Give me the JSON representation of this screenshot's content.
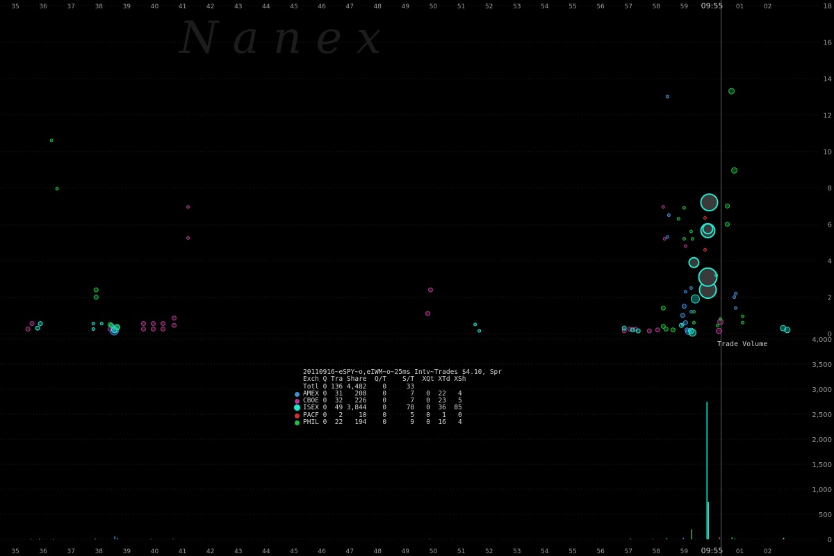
{
  "watermark": "N a n e x",
  "volume_title": "Trade Volume",
  "current_time_label": "09:55",
  "summary": {
    "title": "20110916~eSPY~o,eIWM~o~25ms Intv~Trades $4.10, Spr",
    "header": "Exch Q Tra Share  Q/T    S/T  XQt XTd XSh",
    "total": "Totl 0 136 4,482    0     33",
    "rows": [
      {
        "exch": "AMEX",
        "text": "AMEX 0  31   208    0      7   0  22   4",
        "color": "#3d8fd6"
      },
      {
        "exch": "CBOE",
        "text": "CBOE 0  32   226    0      7   0  23   5",
        "color": "#b03a8e"
      },
      {
        "exch": "ISEX",
        "text": "ISEX 0  49 3,844    0     78   0  36  85",
        "color": "#22e8d0"
      },
      {
        "exch": "PACF",
        "text": "PACF 0   2    10    0      5   0   1   0",
        "color": "#d83030"
      },
      {
        "exch": "PHIL",
        "text": "PHIL 0  22   194    0      9   0  16   4",
        "color": "#22c040"
      }
    ]
  },
  "chart_data": [
    {
      "type": "scatter",
      "title": "",
      "xlabel": "",
      "ylabel": "",
      "x_ticks": [
        "35",
        "36",
        "37",
        "38",
        "39",
        "40",
        "41",
        "42",
        "43",
        "44",
        "45",
        "46",
        "47",
        "48",
        "49",
        "50",
        "51",
        "52",
        "53",
        "54",
        "55",
        "56",
        "57",
        "58",
        "59",
        "09:55",
        "01",
        "02"
      ],
      "ylim": [
        0,
        18
      ],
      "y_ticks": [
        0,
        2,
        4,
        6,
        8,
        10,
        12,
        14,
        16,
        18
      ],
      "legend": "bottom-center table",
      "series": [
        {
          "name": "AMEX",
          "color": "#3d8fd6",
          "points": [
            {
              "x": 38.15,
              "y": 0.35,
              "s": 3
            },
            {
              "x": 38.25,
              "y": 0.2,
              "s": 4
            },
            {
              "x": 38.2,
              "y": 0.15,
              "s": 6
            },
            {
              "x": 58.05,
              "y": 13.0,
              "s": 2
            },
            {
              "x": 58.05,
              "y": 5.3,
              "s": 2
            },
            {
              "x": 58.1,
              "y": 6.5,
              "s": 2
            },
            {
              "x": 58.6,
              "y": 1.0,
              "s": 3
            },
            {
              "x": 58.65,
              "y": 1.5,
              "s": 3
            },
            {
              "x": 58.7,
              "y": 2.3,
              "s": 2
            },
            {
              "x": 58.7,
              "y": 0.6,
              "s": 3
            },
            {
              "x": 58.75,
              "y": 0.2,
              "s": 3
            },
            {
              "x": 58.8,
              "y": 0.1,
              "s": 4
            },
            {
              "x": 58.6,
              "y": 0.5,
              "s": 2
            },
            {
              "x": 58.9,
              "y": 1.2,
              "s": 2
            },
            {
              "x": 58.9,
              "y": 2.5,
              "s": 2
            },
            {
              "x": 60.45,
              "y": 2.0,
              "s": 2
            },
            {
              "x": 60.5,
              "y": 1.4,
              "s": 2
            },
            {
              "x": 60.5,
              "y": 2.2,
              "s": 2
            }
          ]
        },
        {
          "name": "CBOE",
          "color": "#b03a8e",
          "points": [
            {
              "x": 35.1,
              "y": 0.25,
              "s": 3
            },
            {
              "x": 35.25,
              "y": 0.55,
              "s": 3
            },
            {
              "x": 38.05,
              "y": 0.25,
              "s": 3
            },
            {
              "x": 39.25,
              "y": 0.25,
              "s": 3
            },
            {
              "x": 39.25,
              "y": 0.55,
              "s": 3
            },
            {
              "x": 39.6,
              "y": 0.25,
              "s": 3
            },
            {
              "x": 39.6,
              "y": 0.55,
              "s": 3
            },
            {
              "x": 39.95,
              "y": 0.25,
              "s": 3
            },
            {
              "x": 39.95,
              "y": 0.55,
              "s": 3
            },
            {
              "x": 40.35,
              "y": 0.45,
              "s": 3
            },
            {
              "x": 40.35,
              "y": 0.85,
              "s": 3
            },
            {
              "x": 40.85,
              "y": 6.95,
              "s": 2
            },
            {
              "x": 40.85,
              "y": 5.25,
              "s": 2
            },
            {
              "x": 49.45,
              "y": 1.1,
              "s": 3
            },
            {
              "x": 49.55,
              "y": 2.4,
              "s": 3
            },
            {
              "x": 56.5,
              "y": 0.15,
              "s": 3
            },
            {
              "x": 56.7,
              "y": 0.25,
              "s": 3
            },
            {
              "x": 56.9,
              "y": 0.25,
              "s": 3
            },
            {
              "x": 57.4,
              "y": 0.15,
              "s": 3
            },
            {
              "x": 57.7,
              "y": 0.2,
              "s": 3
            },
            {
              "x": 57.9,
              "y": 6.95,
              "s": 2
            },
            {
              "x": 57.95,
              "y": 5.2,
              "s": 2
            },
            {
              "x": 58.7,
              "y": 4.8,
              "s": 2
            },
            {
              "x": 59.9,
              "y": 0.15,
              "s": 4
            },
            {
              "x": 59.95,
              "y": 0.65,
              "s": 4
            }
          ]
        },
        {
          "name": "ISEX",
          "color": "#22e8d0",
          "points": [
            {
              "x": 35.45,
              "y": 0.3,
              "s": 3
            },
            {
              "x": 35.55,
              "y": 0.55,
              "s": 3
            },
            {
              "x": 37.45,
              "y": 0.25,
              "s": 2
            },
            {
              "x": 37.45,
              "y": 0.55,
              "s": 2
            },
            {
              "x": 37.75,
              "y": 0.55,
              "s": 2
            },
            {
              "x": 38.1,
              "y": 0.45,
              "s": 3
            },
            {
              "x": 38.3,
              "y": 0.35,
              "s": 4
            },
            {
              "x": 38.2,
              "y": 0.2,
              "s": 4
            },
            {
              "x": 51.15,
              "y": 0.5,
              "s": 2
            },
            {
              "x": 51.3,
              "y": 0.15,
              "s": 2
            },
            {
              "x": 56.5,
              "y": 0.3,
              "s": 3
            },
            {
              "x": 56.8,
              "y": 0.2,
              "s": 3
            },
            {
              "x": 57.0,
              "y": 0.15,
              "s": 3
            },
            {
              "x": 58.55,
              "y": 0.45,
              "s": 3
            },
            {
              "x": 58.9,
              "y": 0.15,
              "s": 4
            },
            {
              "x": 58.95,
              "y": 0.05,
              "s": 5
            },
            {
              "x": 59.05,
              "y": 1.9,
              "s": 6
            },
            {
              "x": 59.0,
              "y": 3.9,
              "s": 7
            },
            {
              "x": 59.5,
              "y": 2.4,
              "s": 12
            },
            {
              "x": 59.5,
              "y": 3.1,
              "s": 13
            },
            {
              "x": 59.5,
              "y": 5.65,
              "s": 10
            },
            {
              "x": 59.5,
              "y": 5.75,
              "s": 7
            },
            {
              "x": 59.55,
              "y": 7.2,
              "s": 12
            },
            {
              "x": 59.8,
              "y": 3.2,
              "s": 2
            },
            {
              "x": 62.2,
              "y": 0.3,
              "s": 4
            },
            {
              "x": 62.35,
              "y": 0.2,
              "s": 4
            }
          ]
        },
        {
          "name": "PACF",
          "color": "#d83030",
          "points": [
            {
              "x": 59.4,
              "y": 6.35,
              "s": 2
            },
            {
              "x": 59.4,
              "y": 4.6,
              "s": 2
            }
          ]
        },
        {
          "name": "PHIL",
          "color": "#22c040",
          "points": [
            {
              "x": 35.95,
              "y": 10.6,
              "s": 2
            },
            {
              "x": 36.15,
              "y": 7.95,
              "s": 2
            },
            {
              "x": 37.55,
              "y": 2.4,
              "s": 3
            },
            {
              "x": 37.55,
              "y": 2.0,
              "s": 3
            },
            {
              "x": 38.05,
              "y": 0.5,
              "s": 3
            },
            {
              "x": 38.3,
              "y": 0.35,
              "s": 3
            },
            {
              "x": 57.9,
              "y": 1.4,
              "s": 3
            },
            {
              "x": 57.9,
              "y": 0.4,
              "s": 3
            },
            {
              "x": 58.0,
              "y": 0.25,
              "s": 3
            },
            {
              "x": 58.25,
              "y": 0.2,
              "s": 3
            },
            {
              "x": 58.45,
              "y": 6.3,
              "s": 2
            },
            {
              "x": 58.65,
              "y": 6.9,
              "s": 2
            },
            {
              "x": 58.65,
              "y": 5.2,
              "s": 2
            },
            {
              "x": 58.9,
              "y": 5.6,
              "s": 2
            },
            {
              "x": 58.95,
              "y": 5.2,
              "s": 2
            },
            {
              "x": 59.0,
              "y": 1.2,
              "s": 2
            },
            {
              "x": 59.0,
              "y": 0.6,
              "s": 2
            },
            {
              "x": 59.85,
              "y": 0.45,
              "s": 2
            },
            {
              "x": 59.95,
              "y": 0.8,
              "s": 2
            },
            {
              "x": 60.2,
              "y": 7.0,
              "s": 3
            },
            {
              "x": 60.2,
              "y": 6.0,
              "s": 3
            },
            {
              "x": 60.35,
              "y": 13.3,
              "s": 4
            },
            {
              "x": 60.45,
              "y": 8.95,
              "s": 4
            },
            {
              "x": 60.75,
              "y": 0.95,
              "s": 2
            },
            {
              "x": 60.75,
              "y": 0.6,
              "s": 2
            }
          ]
        }
      ]
    },
    {
      "type": "bar",
      "title": "Trade Volume",
      "ylim": [
        0,
        4000
      ],
      "y_ticks": [
        0,
        500,
        1000,
        1500,
        2000,
        2500,
        3000,
        3500,
        4000
      ],
      "x_ticks": [
        "35",
        "36",
        "37",
        "38",
        "39",
        "40",
        "41",
        "42",
        "43",
        "44",
        "45",
        "46",
        "47",
        "48",
        "49",
        "50",
        "51",
        "52",
        "53",
        "54",
        "55",
        "56",
        "57",
        "58",
        "59",
        "09:55",
        "01",
        "02"
      ],
      "bars": [
        {
          "x": 35.2,
          "value": 10,
          "color": "#b03a8e"
        },
        {
          "x": 35.5,
          "value": 10,
          "color": "#22e8d0"
        },
        {
          "x": 36.0,
          "value": 10,
          "color": "#22c040"
        },
        {
          "x": 37.5,
          "value": 15,
          "color": "#22e8d0"
        },
        {
          "x": 38.2,
          "value": 60,
          "color": "#3d8fd6"
        },
        {
          "x": 38.3,
          "value": 20,
          "color": "#22e8d0"
        },
        {
          "x": 39.5,
          "value": 10,
          "color": "#b03a8e"
        },
        {
          "x": 40.3,
          "value": 15,
          "color": "#b03a8e"
        },
        {
          "x": 49.5,
          "value": 12,
          "color": "#b03a8e"
        },
        {
          "x": 56.7,
          "value": 15,
          "color": "#22e8d0"
        },
        {
          "x": 57.5,
          "value": 15,
          "color": "#b03a8e"
        },
        {
          "x": 58.0,
          "value": 25,
          "color": "#22c040"
        },
        {
          "x": 58.6,
          "value": 30,
          "color": "#3d8fd6"
        },
        {
          "x": 58.9,
          "value": 200,
          "color": "#22c040"
        },
        {
          "x": 59.45,
          "value": 2750,
          "color": "#22e8d0"
        },
        {
          "x": 59.5,
          "value": 750,
          "color": "#22e8d0"
        },
        {
          "x": 59.9,
          "value": 40,
          "color": "#b03a8e"
        },
        {
          "x": 60.35,
          "value": 40,
          "color": "#22c040"
        },
        {
          "x": 60.45,
          "value": 20,
          "color": "#22c040"
        },
        {
          "x": 62.2,
          "value": 30,
          "color": "#22e8d0"
        }
      ]
    }
  ]
}
